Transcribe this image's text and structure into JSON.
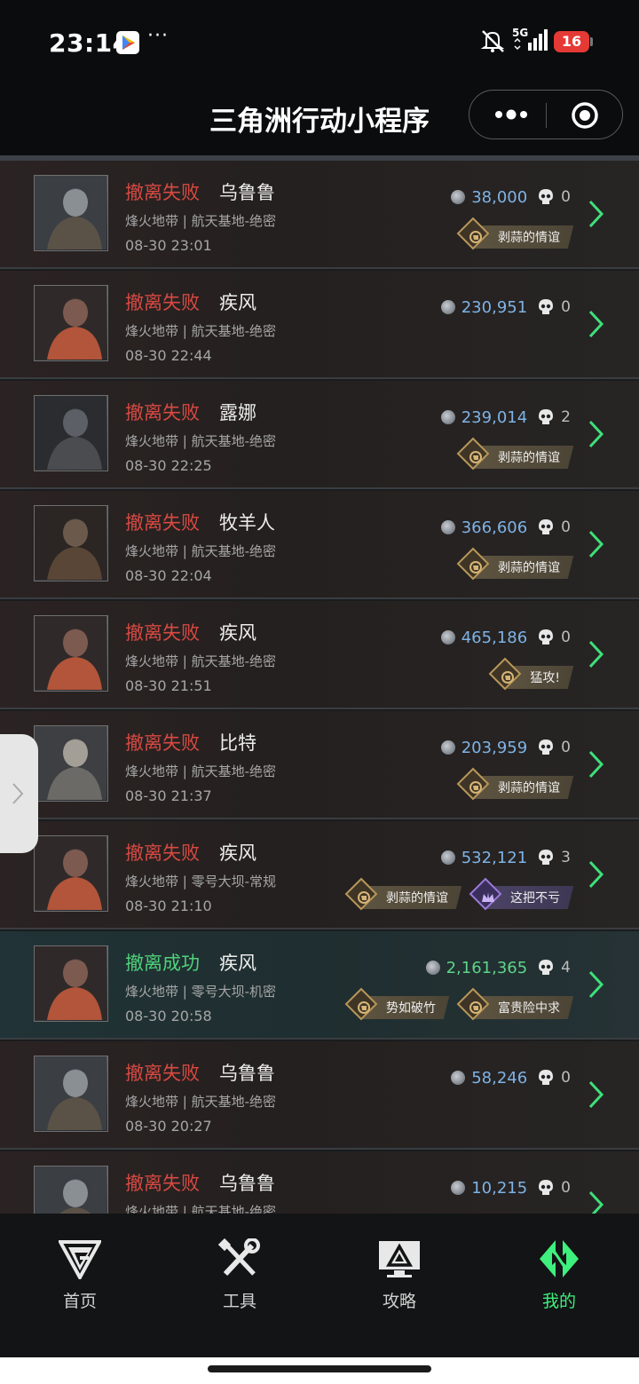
{
  "status": {
    "time": "23:14",
    "dots": "···",
    "network": "5G",
    "battery": "16"
  },
  "header": {
    "title": "三角洲行动小程序"
  },
  "records": [
    {
      "result": "撤离失败",
      "success": false,
      "operator": "乌鲁鲁",
      "map": "烽火地带 | 航天基地-绝密",
      "date": "08-30 23:01",
      "value": "38,000",
      "kills": "0",
      "badges": [
        {
          "label": "剥蒜的情谊",
          "style": "gold"
        }
      ]
    },
    {
      "result": "撤离失败",
      "success": false,
      "operator": "疾风",
      "map": "烽火地带 | 航天基地-绝密",
      "date": "08-30 22:44",
      "value": "230,951",
      "kills": "0",
      "badges": []
    },
    {
      "result": "撤离失败",
      "success": false,
      "operator": "露娜",
      "map": "烽火地带 | 航天基地-绝密",
      "date": "08-30 22:25",
      "value": "239,014",
      "kills": "2",
      "badges": [
        {
          "label": "剥蒜的情谊",
          "style": "gold"
        }
      ]
    },
    {
      "result": "撤离失败",
      "success": false,
      "operator": "牧羊人",
      "map": "烽火地带 | 航天基地-绝密",
      "date": "08-30 22:04",
      "value": "366,606",
      "kills": "0",
      "badges": [
        {
          "label": "剥蒜的情谊",
          "style": "gold"
        }
      ]
    },
    {
      "result": "撤离失败",
      "success": false,
      "operator": "疾风",
      "map": "烽火地带 | 航天基地-绝密",
      "date": "08-30 21:51",
      "value": "465,186",
      "kills": "0",
      "badges": [
        {
          "label": "猛攻!",
          "style": "gold"
        }
      ]
    },
    {
      "result": "撤离失败",
      "success": false,
      "operator": "比特",
      "map": "烽火地带 | 航天基地-绝密",
      "date": "08-30 21:37",
      "value": "203,959",
      "kills": "0",
      "badges": [
        {
          "label": "剥蒜的情谊",
          "style": "gold"
        }
      ]
    },
    {
      "result": "撤离失败",
      "success": false,
      "operator": "疾风",
      "map": "烽火地带 | 零号大坝-常规",
      "date": "08-30 21:10",
      "value": "532,121",
      "kills": "3",
      "badges": [
        {
          "label": "剥蒜的情谊",
          "style": "gold"
        },
        {
          "label": "这把不亏",
          "style": "purple"
        }
      ]
    },
    {
      "result": "撤离成功",
      "success": true,
      "operator": "疾风",
      "map": "烽火地带 | 零号大坝-机密",
      "date": "08-30 20:58",
      "value": "2,161,365",
      "kills": "4",
      "badges": [
        {
          "label": "势如破竹",
          "style": "gold"
        },
        {
          "label": "富贵险中求",
          "style": "gold"
        }
      ]
    },
    {
      "result": "撤离失败",
      "success": false,
      "operator": "乌鲁鲁",
      "map": "烽火地带 | 航天基地-绝密",
      "date": "08-30 20:27",
      "value": "58,246",
      "kills": "0",
      "badges": []
    },
    {
      "result": "撤离失败",
      "success": false,
      "operator": "乌鲁鲁",
      "map": "烽火地带 | 航天基地-绝密",
      "date": "",
      "value": "10,215",
      "kills": "0",
      "badges": []
    }
  ],
  "tabs": [
    {
      "label": "首页",
      "icon": "home-logo-icon",
      "active": false
    },
    {
      "label": "工具",
      "icon": "tools-icon",
      "active": false
    },
    {
      "label": "攻略",
      "icon": "guide-monitor-icon",
      "active": false
    },
    {
      "label": "我的",
      "icon": "profile-emblem-icon",
      "active": true
    }
  ],
  "colors": {
    "fail": "#d74a42",
    "success": "#4fd27a",
    "accent": "#3ef07d",
    "value": "#7fb3e6"
  }
}
